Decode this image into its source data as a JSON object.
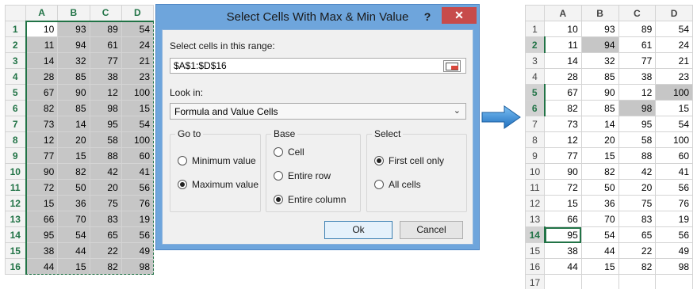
{
  "spreadsheet": {
    "columns": [
      "A",
      "B",
      "C",
      "D"
    ],
    "row_numbers": [
      "1",
      "2",
      "3",
      "4",
      "5",
      "6",
      "7",
      "8",
      "9",
      "10",
      "11",
      "12",
      "13",
      "14",
      "15",
      "16"
    ],
    "rows": [
      [
        "10",
        "93",
        "89",
        "54"
      ],
      [
        "11",
        "94",
        "61",
        "24"
      ],
      [
        "14",
        "32",
        "77",
        "21"
      ],
      [
        "28",
        "85",
        "38",
        "23"
      ],
      [
        "67",
        "90",
        "12",
        "100"
      ],
      [
        "82",
        "85",
        "98",
        "15"
      ],
      [
        "73",
        "14",
        "95",
        "54"
      ],
      [
        "12",
        "20",
        "58",
        "100"
      ],
      [
        "77",
        "15",
        "88",
        "60"
      ],
      [
        "90",
        "82",
        "42",
        "41"
      ],
      [
        "72",
        "50",
        "20",
        "56"
      ],
      [
        "15",
        "36",
        "75",
        "76"
      ],
      [
        "66",
        "70",
        "83",
        "19"
      ],
      [
        "95",
        "54",
        "65",
        "56"
      ],
      [
        "38",
        "44",
        "22",
        "49"
      ],
      [
        "44",
        "15",
        "82",
        "98"
      ]
    ]
  },
  "result_spreadsheet": {
    "extra_row_number": "17",
    "highlighted_rows": [
      "2",
      "5",
      "6",
      "14"
    ]
  },
  "dialog": {
    "title": "Select Cells With Max & Min Value",
    "help_label": "?",
    "close_label": "✕",
    "range_label": "Select cells in this range:",
    "range_value": "$A$1:$D$16",
    "look_in_label": "Look in:",
    "look_in_value": "Formula and Value Cells",
    "go_to": {
      "title": "Go to",
      "options": [
        "Minimum value",
        "Maximum value"
      ],
      "selected": "Maximum value"
    },
    "base": {
      "title": "Base",
      "options": [
        "Cell",
        "Entire row",
        "Entire column"
      ],
      "selected": "Entire column"
    },
    "select": {
      "title": "Select",
      "options": [
        "First cell only",
        "All cells"
      ],
      "selected": "First cell only"
    },
    "ok_label": "Ok",
    "cancel_label": "Cancel"
  },
  "colors": {
    "excel_green": "#217346",
    "selection_gray": "#c6c6c6",
    "dialog_frame": "#6ea5dc",
    "close_red": "#c74b4b",
    "arrow_blue": "#3a8fd6"
  },
  "icons": {
    "arrow": "right-arrow-icon",
    "range_picker": "range-select-icon"
  }
}
